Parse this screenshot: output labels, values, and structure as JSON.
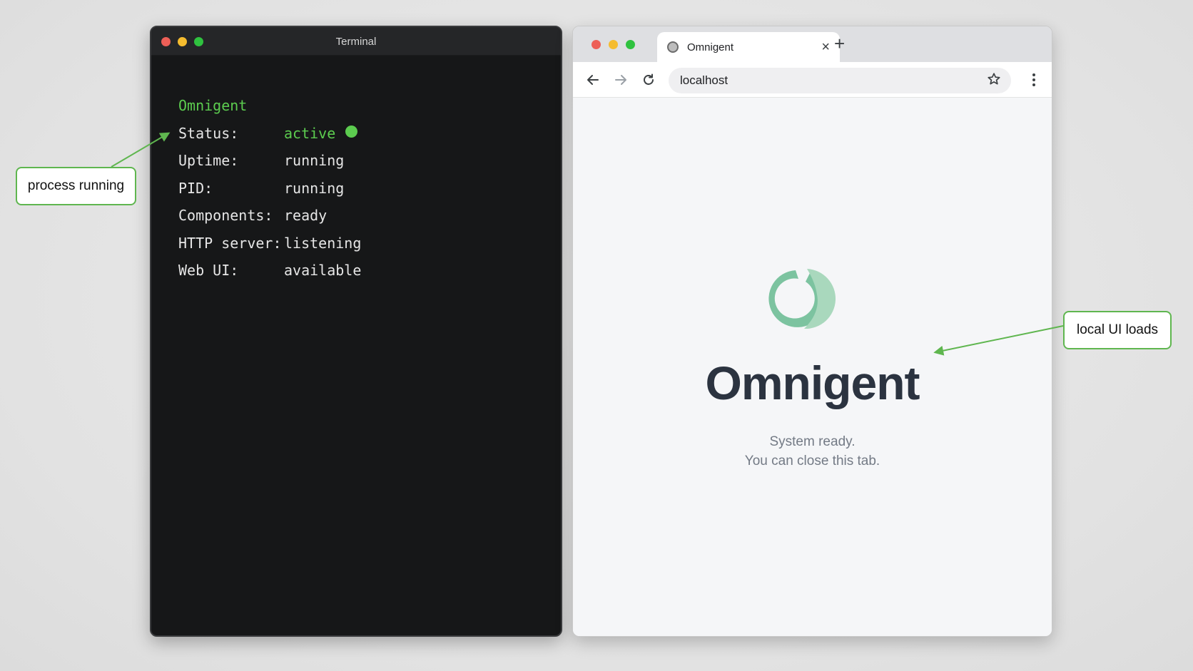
{
  "terminal": {
    "title": "Terminal",
    "app_name": "Omnigent",
    "rows": [
      {
        "key": "Status:",
        "value": "active"
      },
      {
        "key": "Uptime:",
        "value": "running"
      },
      {
        "key": "PID:",
        "value": "running"
      },
      {
        "key": "Components:",
        "value": "ready"
      },
      {
        "key": "HTTP server:",
        "value": "listening"
      },
      {
        "key": "Web UI:",
        "value": "available"
      }
    ],
    "accent_color": "#5ccc4f"
  },
  "browser": {
    "tab_title": "Omnigent",
    "address": "localhost",
    "page": {
      "brand": "Omnigent",
      "line1": "System ready.",
      "line2": "You can close this tab."
    },
    "logo_color": "#7cc3a0"
  },
  "callouts": {
    "left": "process running",
    "right": "local UI loads",
    "color": "#5fb64f"
  },
  "icons": {
    "back": "arrow-left-icon",
    "forward": "arrow-right-icon",
    "reload": "reload-icon",
    "bookmark": "star-icon",
    "menu": "kebab-menu-icon",
    "close_tab": "close-icon",
    "new_tab": "plus-icon"
  }
}
